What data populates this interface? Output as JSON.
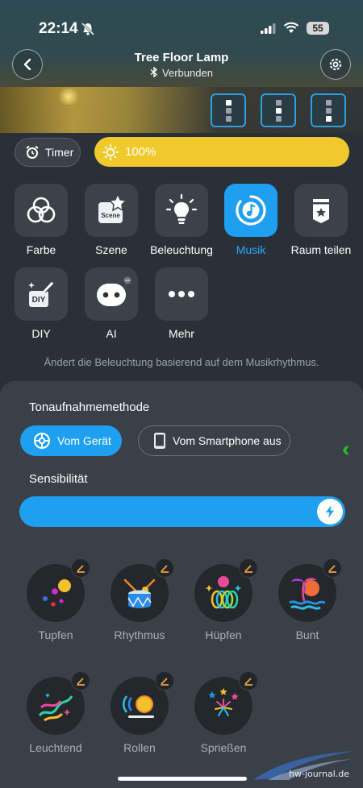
{
  "status_bar": {
    "time": "22:14",
    "battery": "55"
  },
  "header": {
    "title": "Tree Floor Lamp",
    "connection": "Verbunden"
  },
  "controls": {
    "timer_label": "Timer",
    "brightness": "100%",
    "brightness_value": 100
  },
  "modes": [
    {
      "label": "Farbe",
      "icon": "color-circles-icon",
      "active": false
    },
    {
      "label": "Szene",
      "icon": "scene-icon",
      "active": false,
      "badge": "Scene"
    },
    {
      "label": "Beleuchtung",
      "icon": "bulb-icon",
      "active": false
    },
    {
      "label": "Musik",
      "icon": "music-icon",
      "active": true
    },
    {
      "label": "Raum teilen",
      "icon": "share-room-icon",
      "active": false
    },
    {
      "label": "DIY",
      "icon": "diy-icon",
      "active": false,
      "badge": "DIY"
    },
    {
      "label": "AI",
      "icon": "ai-robot-icon",
      "active": false
    },
    {
      "label": "Mehr",
      "icon": "more-icon",
      "active": false
    }
  ],
  "description": "Ändert die Beleuchtung basierend auf dem Musikrhythmus.",
  "panel": {
    "recording_title": "Tonaufnahmemethode",
    "method_device": "Vom Gerät",
    "method_phone": "Vom Smartphone aus",
    "sensitivity_title": "Sensibilität",
    "sensitivity_value": 1.0
  },
  "effects": [
    {
      "label": "Tupfen",
      "icon": "dots-effect-icon"
    },
    {
      "label": "Rhythmus",
      "icon": "drum-effect-icon"
    },
    {
      "label": "Hüpfen",
      "icon": "bounce-effect-icon"
    },
    {
      "label": "Bunt",
      "icon": "palm-effect-icon"
    },
    {
      "label": "Leuchtend",
      "icon": "glow-effect-icon"
    },
    {
      "label": "Rollen",
      "icon": "roll-effect-icon"
    },
    {
      "label": "Sprießen",
      "icon": "fireworks-effect-icon"
    }
  ],
  "watermark": "hw-journal.de",
  "colors": {
    "accent": "#1f9ff0",
    "brightness": "#f0c92c",
    "chevron": "#22c22a"
  }
}
